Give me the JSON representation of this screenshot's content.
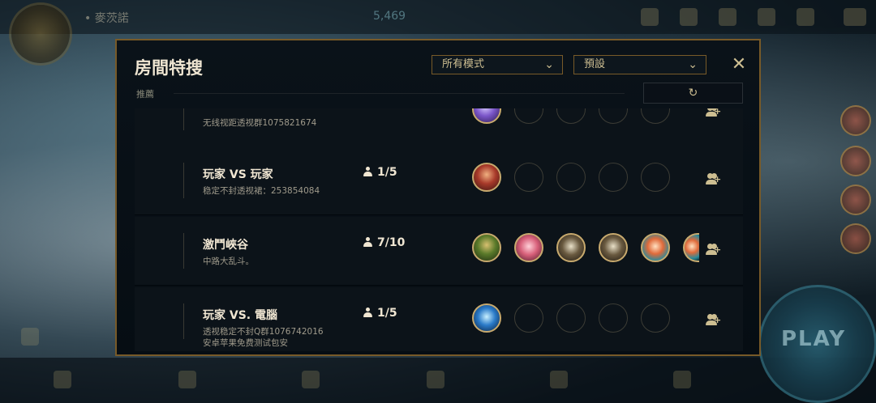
{
  "background": {
    "summoner_name": "• 麥茨諾",
    "currency": "5,469",
    "play_label": "PLAY"
  },
  "modal": {
    "title": "房間特搜",
    "mode_dropdown": "所有模式",
    "preset_dropdown": "預設",
    "recommend_label": "推薦",
    "close_icon": "✕",
    "refresh_icon": "↻"
  },
  "rooms": [
    {
      "name": "",
      "desc": "无线视距透视群1075821674",
      "count": "",
      "avatars": [
        "purple-creature"
      ],
      "empty_slots": 4
    },
    {
      "name": "玩家 VS 玩家",
      "desc": "稳定不封透视裙：253854084",
      "count": "1/5",
      "avatars": [
        "red-minion"
      ],
      "empty_slots": 4
    },
    {
      "name": "激鬥峽谷",
      "desc": "中路大乱斗。",
      "count": "7/10",
      "avatars": [
        "teemo",
        "poro",
        "knight-helm",
        "knight-helm",
        "fox",
        "fox"
      ],
      "empty_slots": 0
    },
    {
      "name": "玩家 VS. 電腦",
      "desc": "透视稳定不封Q群1076742016\n安卓苹果免费测试包安",
      "count": "1/5",
      "avatars": [
        "blue-spirit"
      ],
      "empty_slots": 4
    }
  ],
  "colors": {
    "gold": "#c8aa6e",
    "border": "#785a28",
    "panel": "#010a13",
    "text": "#f0e6d2"
  }
}
